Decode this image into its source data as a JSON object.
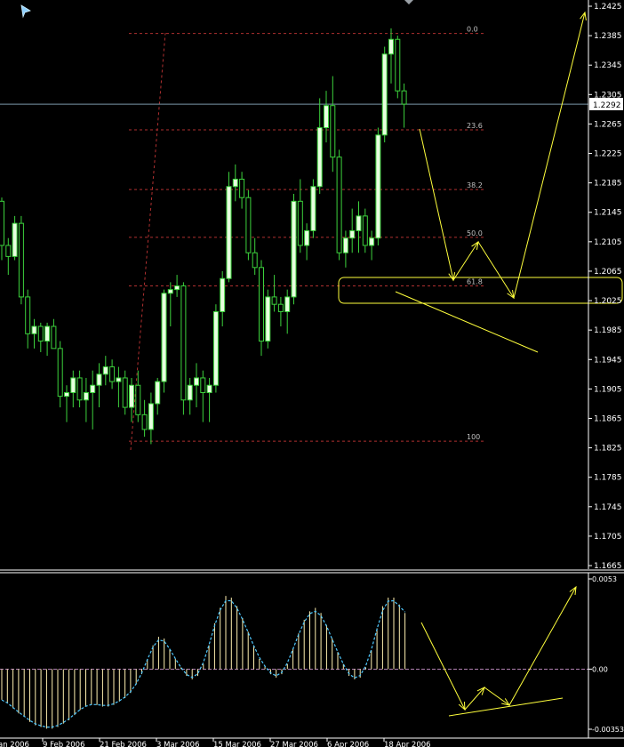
{
  "chart_data": [
    {
      "type": "candlestick",
      "price_axis": {
        "ylim": [
          1.1645,
          1.2435
        ],
        "ticks": [
          "1.2425",
          "1.2385",
          "1.2345",
          "1.2305",
          "1.2265",
          "1.2225",
          "1.2185",
          "1.2145",
          "1.2105",
          "1.2065",
          "1.2025",
          "1.1985",
          "1.1945",
          "1.1905",
          "1.1865",
          "1.1825",
          "1.1785",
          "1.1745",
          "1.1705",
          "1.1665"
        ],
        "current_price": "1.2292"
      },
      "time_axis": {
        "labels": [
          "an 2006",
          "9 Feb 2006",
          "21 Feb 2006",
          "3 Mar 2006",
          "15 Mar 2006",
          "27 Mar 2006",
          "6 Apr 2006",
          "18 Apr 2006"
        ]
      },
      "fibonacci": {
        "levels": [
          {
            "label": "0.0",
            "value": 1.2388
          },
          {
            "label": "23.6",
            "value": 1.2257
          },
          {
            "label": "38.2",
            "value": 1.2176
          },
          {
            "label": "50.0",
            "value": 1.2111
          },
          {
            "label": "61.8",
            "value": 1.2045
          },
          {
            "label": "100",
            "value": 1.1834
          }
        ]
      },
      "candles": [
        [
          1.216,
          1.2165,
          1.208,
          1.21
        ],
        [
          1.21,
          1.211,
          1.206,
          1.2085
        ],
        [
          1.2085,
          1.214,
          1.208,
          1.213
        ],
        [
          1.213,
          1.214,
          1.202,
          1.203
        ],
        [
          1.203,
          1.204,
          1.196,
          1.198
        ],
        [
          1.198,
          1.2,
          1.196,
          1.199
        ],
        [
          1.199,
          1.1995,
          1.1955,
          1.197
        ],
        [
          1.197,
          1.1995,
          1.195,
          1.199
        ],
        [
          1.199,
          1.2,
          1.196,
          1.196
        ],
        [
          1.196,
          1.197,
          1.188,
          1.1895
        ],
        [
          1.1895,
          1.191,
          1.186,
          1.19
        ],
        [
          1.19,
          1.193,
          1.188,
          1.192
        ],
        [
          1.192,
          1.193,
          1.188,
          1.189
        ],
        [
          1.189,
          1.192,
          1.186,
          1.19
        ],
        [
          1.19,
          1.193,
          1.185,
          1.191
        ],
        [
          1.191,
          1.194,
          1.188,
          1.1925
        ],
        [
          1.1925,
          1.195,
          1.191,
          1.1935
        ],
        [
          1.1935,
          1.1945,
          1.1905,
          1.1915
        ],
        [
          1.1915,
          1.1935,
          1.188,
          1.192
        ],
        [
          1.192,
          1.193,
          1.187,
          1.188
        ],
        [
          1.188,
          1.192,
          1.186,
          1.191
        ],
        [
          1.191,
          1.193,
          1.186,
          1.187
        ],
        [
          1.187,
          1.189,
          1.184,
          1.185
        ],
        [
          1.185,
          1.19,
          1.183,
          1.1885
        ],
        [
          1.1885,
          1.192,
          1.187,
          1.1915
        ],
        [
          1.1915,
          1.204,
          1.19,
          1.2035
        ],
        [
          1.2035,
          1.205,
          1.199,
          1.204
        ],
        [
          1.204,
          1.206,
          1.203,
          1.2045
        ],
        [
          1.2045,
          1.205,
          1.187,
          1.189
        ],
        [
          1.189,
          1.192,
          1.187,
          1.191
        ],
        [
          1.191,
          1.194,
          1.188,
          1.192
        ],
        [
          1.192,
          1.193,
          1.186,
          1.19
        ],
        [
          1.19,
          1.192,
          1.186,
          1.191
        ],
        [
          1.191,
          1.202,
          1.19,
          1.201
        ],
        [
          1.201,
          1.2065,
          1.199,
          1.2055
        ],
        [
          1.2055,
          1.22,
          1.205,
          1.218
        ],
        [
          1.218,
          1.221,
          1.216,
          1.219
        ],
        [
          1.219,
          1.22,
          1.215,
          1.2165
        ],
        [
          1.2165,
          1.2175,
          1.208,
          1.209
        ],
        [
          1.209,
          1.211,
          1.206,
          1.207
        ],
        [
          1.207,
          1.208,
          1.195,
          1.197
        ],
        [
          1.197,
          1.204,
          1.196,
          1.203
        ],
        [
          1.203,
          1.206,
          1.201,
          1.202
        ],
        [
          1.202,
          1.203,
          1.199,
          1.201
        ],
        [
          1.201,
          1.204,
          1.198,
          1.203
        ],
        [
          1.203,
          1.217,
          1.202,
          1.216
        ],
        [
          1.216,
          1.219,
          1.209,
          1.21
        ],
        [
          1.21,
          1.213,
          1.208,
          1.212
        ],
        [
          1.212,
          1.219,
          1.211,
          1.218
        ],
        [
          1.218,
          1.23,
          1.217,
          1.226
        ],
        [
          1.226,
          1.231,
          1.224,
          1.229
        ],
        [
          1.229,
          1.233,
          1.22,
          1.222
        ],
        [
          1.222,
          1.223,
          1.208,
          1.209
        ],
        [
          1.209,
          1.212,
          1.207,
          1.211
        ],
        [
          1.211,
          1.215,
          1.209,
          1.212
        ],
        [
          1.212,
          1.216,
          1.209,
          1.214
        ],
        [
          1.214,
          1.215,
          1.209,
          1.21
        ],
        [
          1.21,
          1.212,
          1.208,
          1.211
        ],
        [
          1.211,
          1.226,
          1.21,
          1.225
        ],
        [
          1.225,
          1.237,
          1.224,
          1.236
        ],
        [
          1.236,
          1.2395,
          1.232,
          1.238
        ],
        [
          1.238,
          1.2385,
          1.23,
          1.231
        ],
        [
          1.231,
          1.232,
          1.226,
          1.2292
        ]
      ],
      "annotations": {
        "projection_path_main": [
          [
            472,
            145
          ],
          [
            510,
            315
          ],
          [
            538,
            272
          ],
          [
            578,
            335
          ],
          [
            658,
            14
          ]
        ],
        "projection_lines_extra": [
          [
            [
              445,
              328
            ],
            [
              605,
              396
            ]
          ]
        ],
        "support_zone_box": [
          381,
          312,
          700,
          341
        ]
      }
    },
    {
      "type": "histogram",
      "indicator_axis": {
        "ylim": [
          -0.00353,
          0.0053
        ],
        "ticks": [
          "0.0053",
          "0.00",
          "-0.00353"
        ],
        "zero": 0
      },
      "bar_values": [
        -0.0018,
        -0.002,
        -0.0023,
        -0.0026,
        -0.0028,
        -0.0031,
        -0.0033,
        -0.0034,
        -0.0035,
        -0.0035,
        -0.0034,
        -0.0032,
        -0.003,
        -0.0027,
        -0.0024,
        -0.0022,
        -0.0021,
        -0.0021,
        -0.0022,
        -0.0022,
        -0.0021,
        -0.0019,
        -0.0017,
        -0.0014,
        -0.0009,
        -0.0003,
        0.0006,
        0.0014,
        0.0019,
        0.0018,
        0.0012,
        0.0006,
        0.0001,
        -0.0004,
        -0.0006,
        -0.0004,
        0.0003,
        0.0014,
        0.0027,
        0.0036,
        0.0043,
        0.0042,
        0.0037,
        0.003,
        0.0022,
        0.0014,
        0.0006,
        0.0002,
        -0.0003,
        -0.0005,
        -0.0003,
        0.0003,
        0.0012,
        0.0021,
        0.0029,
        0.0034,
        0.0036,
        0.0033,
        0.0026,
        0.0018,
        0.001,
        0.0003,
        -0.0004,
        -0.0006,
        -0.0005,
        0.0001,
        0.0011,
        0.0024,
        0.0037,
        0.0042,
        0.0042,
        0.0038,
        0.0033
      ],
      "annotations": {
        "projection_path": [
          [
            474,
            700
          ],
          [
            523,
            798
          ],
          [
            545,
            773
          ],
          [
            573,
            793
          ],
          [
            648,
            660
          ]
        ],
        "projection_lines_extra": [
          [
            [
              505,
              805
            ],
            [
              633,
              785
            ]
          ]
        ]
      }
    }
  ],
  "colors": {
    "background": "#000000",
    "axis_text": "#ffffff",
    "bull_body": "#e8ffe0",
    "bear_body": "#000000",
    "wick": "#3cd23c",
    "fib_line": "#b03030",
    "fib_text": "#c0c0c0",
    "current_price_line": "#7a96a8",
    "annotation": "#ffff3c",
    "histogram_bar": "#fff0b0",
    "signal_line": "#4ec8ff",
    "zero_line": "#b080b0"
  }
}
